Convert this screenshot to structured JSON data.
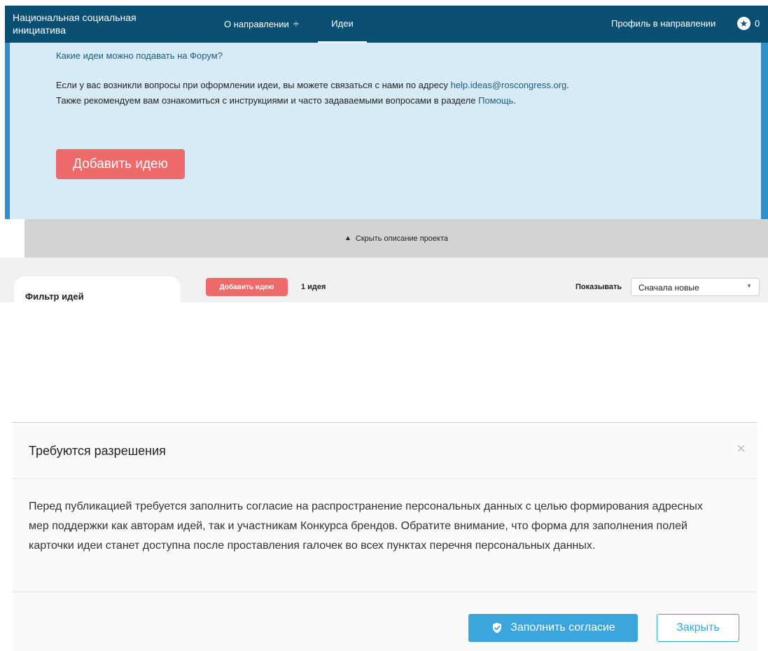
{
  "nav": {
    "brand": "Национальная социальная инициатива",
    "about": "О направлении",
    "ideas": "Идеи",
    "profile": "Профиль в направлении",
    "points": "0"
  },
  "description": {
    "question_link": "Какие идеи можно подавать на Форум?",
    "contact_text": "Если у вас возникли вопросы при оформлении идеи, вы можете связаться с нами по адресу",
    "contact_email": "help.ideas@roscongress.org",
    "contact_end": ".",
    "help_text": "Также рекомендуем вам ознакомиться с инструкциями и часто задаваемыми вопросами в разделе",
    "help_link": "Помощь",
    "help_end": ".",
    "add_button": "Добавить идею"
  },
  "collapse": {
    "label": "Скрыть описание проекта"
  },
  "ideas": {
    "filter_title": "Фильтр идей",
    "add_button": "Добавить идею",
    "count": "1 идея",
    "show_label": "Показывать",
    "sort_selected": "Сначала новые"
  },
  "modal": {
    "title": "Требуются разрешения",
    "close_glyph": "×",
    "body": "Перед публикацией требуется заполнить согласие на распространение персональных данных с целью формирования адресных мер поддержки как авторам идей, так и участникам Конкурса брендов. Обратите внимание, что форма для заполнения полей карточки идеи станет доступна после проставления галочек во всех пунктах перечня персональных данных.",
    "consent_button": "Заполнить согласие",
    "close_button": "Закрыть"
  },
  "colors": {
    "nav_bg": "#0b4f72",
    "panel_bg": "#d6ebf6",
    "accent_red": "#ef6b6b",
    "accent_blue": "#3aa6dd"
  }
}
